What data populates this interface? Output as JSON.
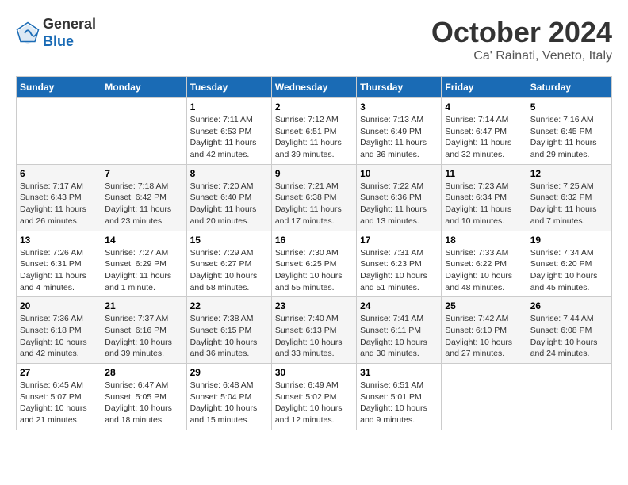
{
  "header": {
    "logo_general": "General",
    "logo_blue": "Blue",
    "month_title": "October 2024",
    "subtitle": "Ca' Rainati, Veneto, Italy"
  },
  "calendar": {
    "headers": [
      "Sunday",
      "Monday",
      "Tuesday",
      "Wednesday",
      "Thursday",
      "Friday",
      "Saturday"
    ],
    "weeks": [
      [
        {
          "day": "",
          "info": ""
        },
        {
          "day": "",
          "info": ""
        },
        {
          "day": "1",
          "info": "Sunrise: 7:11 AM\nSunset: 6:53 PM\nDaylight: 11 hours\nand 42 minutes."
        },
        {
          "day": "2",
          "info": "Sunrise: 7:12 AM\nSunset: 6:51 PM\nDaylight: 11 hours\nand 39 minutes."
        },
        {
          "day": "3",
          "info": "Sunrise: 7:13 AM\nSunset: 6:49 PM\nDaylight: 11 hours\nand 36 minutes."
        },
        {
          "day": "4",
          "info": "Sunrise: 7:14 AM\nSunset: 6:47 PM\nDaylight: 11 hours\nand 32 minutes."
        },
        {
          "day": "5",
          "info": "Sunrise: 7:16 AM\nSunset: 6:45 PM\nDaylight: 11 hours\nand 29 minutes."
        }
      ],
      [
        {
          "day": "6",
          "info": "Sunrise: 7:17 AM\nSunset: 6:43 PM\nDaylight: 11 hours\nand 26 minutes."
        },
        {
          "day": "7",
          "info": "Sunrise: 7:18 AM\nSunset: 6:42 PM\nDaylight: 11 hours\nand 23 minutes."
        },
        {
          "day": "8",
          "info": "Sunrise: 7:20 AM\nSunset: 6:40 PM\nDaylight: 11 hours\nand 20 minutes."
        },
        {
          "day": "9",
          "info": "Sunrise: 7:21 AM\nSunset: 6:38 PM\nDaylight: 11 hours\nand 17 minutes."
        },
        {
          "day": "10",
          "info": "Sunrise: 7:22 AM\nSunset: 6:36 PM\nDaylight: 11 hours\nand 13 minutes."
        },
        {
          "day": "11",
          "info": "Sunrise: 7:23 AM\nSunset: 6:34 PM\nDaylight: 11 hours\nand 10 minutes."
        },
        {
          "day": "12",
          "info": "Sunrise: 7:25 AM\nSunset: 6:32 PM\nDaylight: 11 hours\nand 7 minutes."
        }
      ],
      [
        {
          "day": "13",
          "info": "Sunrise: 7:26 AM\nSunset: 6:31 PM\nDaylight: 11 hours\nand 4 minutes."
        },
        {
          "day": "14",
          "info": "Sunrise: 7:27 AM\nSunset: 6:29 PM\nDaylight: 11 hours\nand 1 minute."
        },
        {
          "day": "15",
          "info": "Sunrise: 7:29 AM\nSunset: 6:27 PM\nDaylight: 10 hours\nand 58 minutes."
        },
        {
          "day": "16",
          "info": "Sunrise: 7:30 AM\nSunset: 6:25 PM\nDaylight: 10 hours\nand 55 minutes."
        },
        {
          "day": "17",
          "info": "Sunrise: 7:31 AM\nSunset: 6:23 PM\nDaylight: 10 hours\nand 51 minutes."
        },
        {
          "day": "18",
          "info": "Sunrise: 7:33 AM\nSunset: 6:22 PM\nDaylight: 10 hours\nand 48 minutes."
        },
        {
          "day": "19",
          "info": "Sunrise: 7:34 AM\nSunset: 6:20 PM\nDaylight: 10 hours\nand 45 minutes."
        }
      ],
      [
        {
          "day": "20",
          "info": "Sunrise: 7:36 AM\nSunset: 6:18 PM\nDaylight: 10 hours\nand 42 minutes."
        },
        {
          "day": "21",
          "info": "Sunrise: 7:37 AM\nSunset: 6:16 PM\nDaylight: 10 hours\nand 39 minutes."
        },
        {
          "day": "22",
          "info": "Sunrise: 7:38 AM\nSunset: 6:15 PM\nDaylight: 10 hours\nand 36 minutes."
        },
        {
          "day": "23",
          "info": "Sunrise: 7:40 AM\nSunset: 6:13 PM\nDaylight: 10 hours\nand 33 minutes."
        },
        {
          "day": "24",
          "info": "Sunrise: 7:41 AM\nSunset: 6:11 PM\nDaylight: 10 hours\nand 30 minutes."
        },
        {
          "day": "25",
          "info": "Sunrise: 7:42 AM\nSunset: 6:10 PM\nDaylight: 10 hours\nand 27 minutes."
        },
        {
          "day": "26",
          "info": "Sunrise: 7:44 AM\nSunset: 6:08 PM\nDaylight: 10 hours\nand 24 minutes."
        }
      ],
      [
        {
          "day": "27",
          "info": "Sunrise: 6:45 AM\nSunset: 5:07 PM\nDaylight: 10 hours\nand 21 minutes."
        },
        {
          "day": "28",
          "info": "Sunrise: 6:47 AM\nSunset: 5:05 PM\nDaylight: 10 hours\nand 18 minutes."
        },
        {
          "day": "29",
          "info": "Sunrise: 6:48 AM\nSunset: 5:04 PM\nDaylight: 10 hours\nand 15 minutes."
        },
        {
          "day": "30",
          "info": "Sunrise: 6:49 AM\nSunset: 5:02 PM\nDaylight: 10 hours\nand 12 minutes."
        },
        {
          "day": "31",
          "info": "Sunrise: 6:51 AM\nSunset: 5:01 PM\nDaylight: 10 hours\nand 9 minutes."
        },
        {
          "day": "",
          "info": ""
        },
        {
          "day": "",
          "info": ""
        }
      ]
    ]
  }
}
